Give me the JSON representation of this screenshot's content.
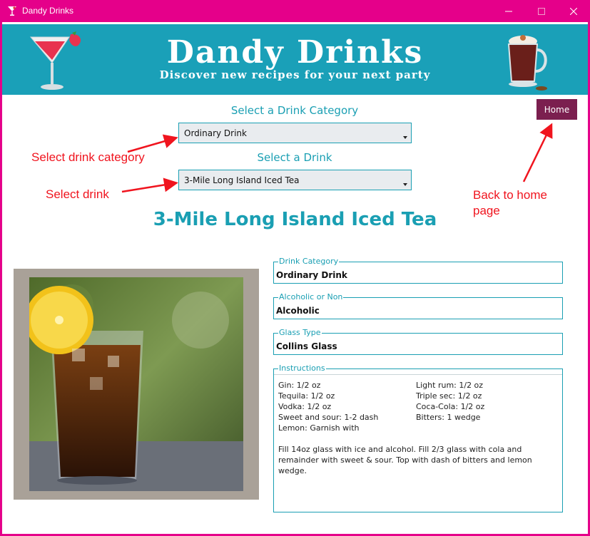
{
  "window": {
    "title": "Dandy Drinks",
    "controls": {
      "minimize": "minimize-icon",
      "maximize": "maximize-icon",
      "close": "close-icon"
    }
  },
  "banner": {
    "title": "Dandy Drinks",
    "subtitle": "Discover new recipes for your next party"
  },
  "selectors": {
    "category_label": "Select a Drink Category",
    "category_value": "Ordinary Drink",
    "drink_label": "Select a Drink",
    "drink_value": "3-Mile Long Island Iced Tea"
  },
  "home_button": "Home",
  "annotations": {
    "category": "Select drink category",
    "drink": "Select drink",
    "home_line1": "Back to home",
    "home_line2": "page"
  },
  "drink": {
    "name": "3-Mile Long Island Iced Tea",
    "category_legend": "Drink Category",
    "category": "Ordinary Drink",
    "alcoholic_legend": "Alcoholic or Non",
    "alcoholic": "Alcoholic",
    "glass_legend": "Glass Type",
    "glass": "Collins Glass",
    "instructions_legend": "Instructions",
    "ingredients_left": [
      "Gin: 1/2 oz",
      "Tequila: 1/2 oz",
      "Vodka: 1/2 oz",
      "Sweet and sour: 1-2 dash",
      "Lemon: Garnish with"
    ],
    "ingredients_right": [
      "Light rum: 1/2 oz",
      "Triple sec: 1/2 oz",
      "Coca-Cola: 1/2 oz",
      "Bitters: 1 wedge"
    ],
    "instructions": "Fill 14oz glass with ice and alcohol. Fill 2/3 glass with cola and remainder with sweet & sour. Top with dash of bitters and lemon wedge."
  },
  "colors": {
    "titlebar": "#e5008a",
    "banner": "#1aa0b8",
    "accent": "#1a9fb3",
    "home": "#7b1f4f",
    "annotation": "#f0141e"
  }
}
